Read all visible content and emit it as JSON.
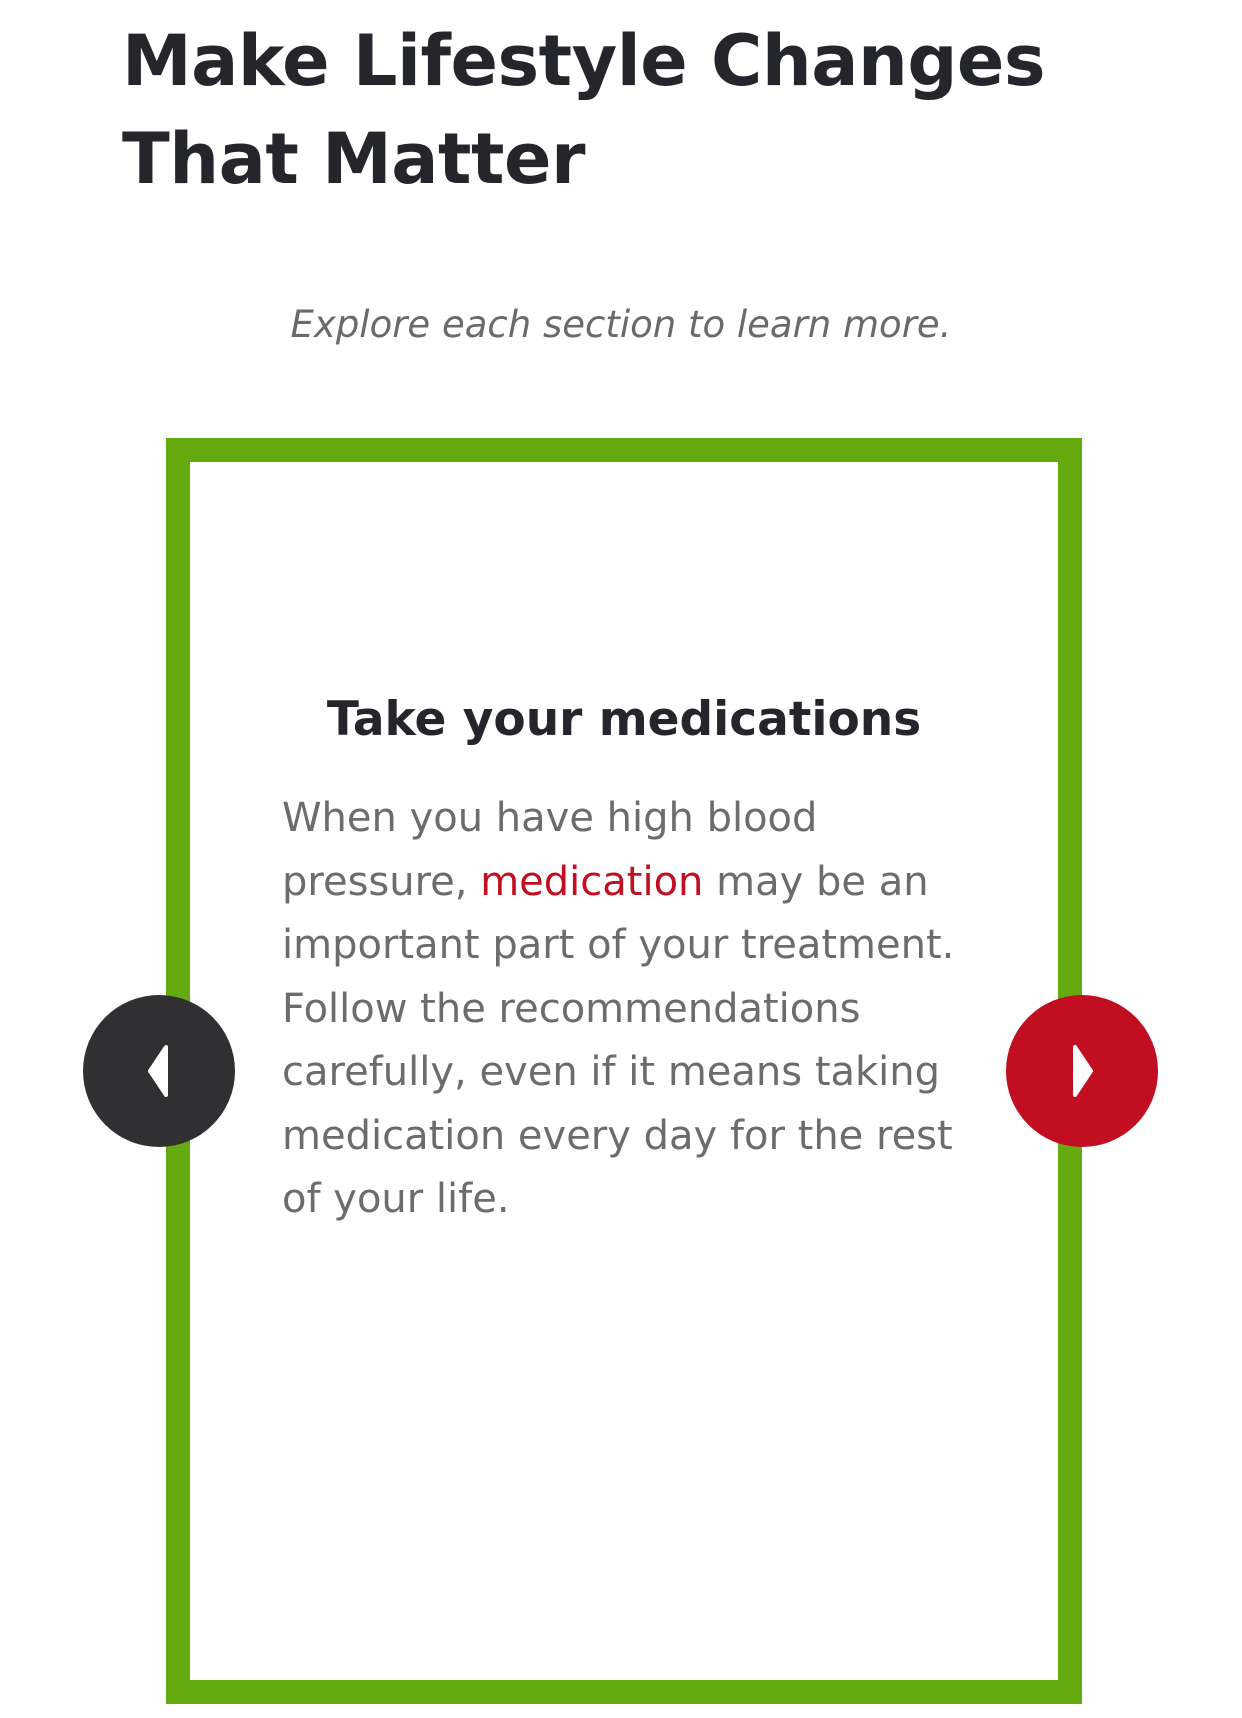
{
  "header": {
    "title_line1": "Make Lifestyle Changes",
    "title_line2": "That Matter",
    "subtitle": "Explore each section to learn more."
  },
  "carousel": {
    "card": {
      "title": "Take your medications",
      "body_before_link": "When you have high blood pressure, ",
      "link_text": "medication",
      "body_after_link": " may be an important part of your treatment. Follow the recommendations carefully, even if it means taking medication every day for the rest of your life."
    },
    "prev_icon": "chevron-left-icon",
    "next_icon": "chevron-right-icon"
  },
  "colors": {
    "card_border": "#66aa12",
    "link": "#c10e21",
    "prev_button": "#303033",
    "next_button": "#c10e21",
    "heading": "#25262b",
    "body_text": "#6c6c6c"
  }
}
